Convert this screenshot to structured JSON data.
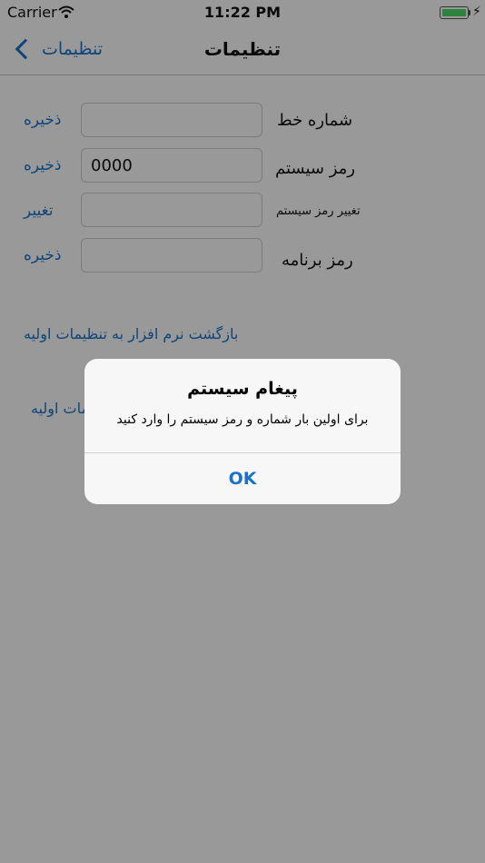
{
  "status_bar": {
    "carrier": "Carrier",
    "time": "11:22 PM",
    "icons": [
      "wifi-icon",
      "battery-icon",
      "charging-bolt-icon"
    ]
  },
  "nav": {
    "back_label": "تنظیمات",
    "title": "تنظیمات"
  },
  "form": {
    "rows": [
      {
        "label": "شماره خط",
        "value": "",
        "action": "ذخیره"
      },
      {
        "label": "رمز سیستم",
        "value": "0000",
        "action": "ذخیره"
      },
      {
        "label": "تغییر رمز سیستم",
        "value": "",
        "action": "تغییر"
      },
      {
        "label": "رمز برنامه",
        "value": "",
        "action": "ذخیره"
      }
    ],
    "reset_link": "بازگشت نرم افزار به تنظیمات اولیه",
    "partial_link": "مات اولیه"
  },
  "alert": {
    "title": "پیغام سیستم",
    "message": "برای اولین بار شماره و رمز سیستم را وارد کنید",
    "ok_label": "OK"
  },
  "colors": {
    "accent": "#1a73c9",
    "battery": "#4cd964",
    "overlay": "rgba(0,0,0,0.40)"
  }
}
